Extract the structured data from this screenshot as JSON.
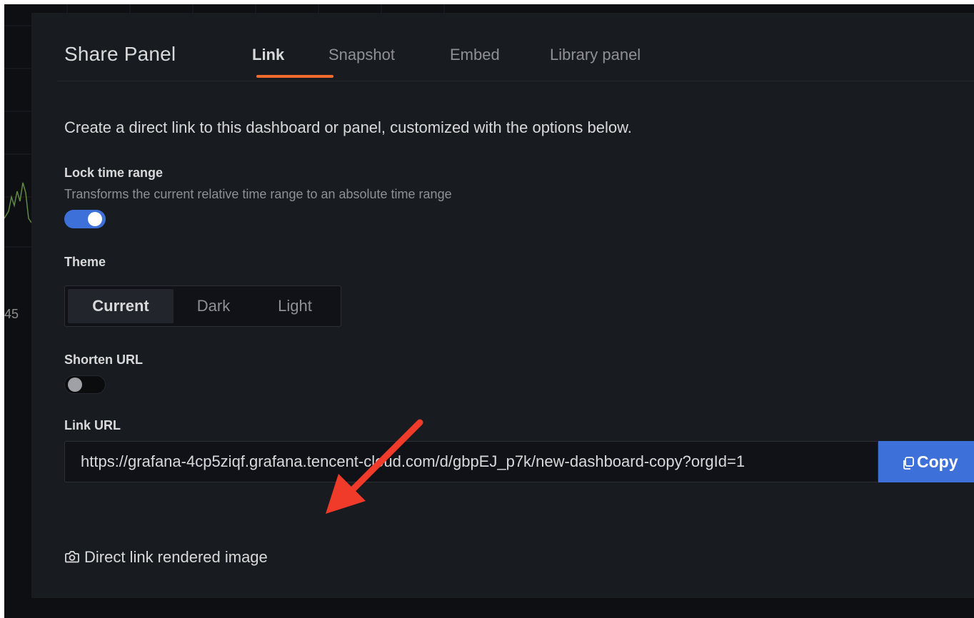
{
  "background": {
    "axis_label": "45"
  },
  "modal": {
    "title": "Share Panel",
    "tabs": [
      {
        "label": "Link",
        "active": true
      },
      {
        "label": "Snapshot",
        "active": false
      },
      {
        "label": "Embed",
        "active": false
      },
      {
        "label": "Library panel",
        "active": false
      }
    ],
    "close_glyph": "×"
  },
  "link_tab": {
    "description": "Create a direct link to this dashboard or panel, customized with the options below.",
    "lock_time_range": {
      "label": "Lock time range",
      "description": "Transforms the current relative time range to an absolute time range",
      "enabled": true
    },
    "theme": {
      "label": "Theme",
      "options": [
        "Current",
        "Dark",
        "Light"
      ],
      "selected": "Current"
    },
    "shorten_url": {
      "label": "Shorten URL",
      "enabled": false
    },
    "link_url": {
      "label": "Link URL",
      "value": "https://grafana-4cp5ziqf.grafana.tencent-cloud.com/d/gbpEJ_p7k/new-dashboard-copy?orgId=1",
      "copy_label": "Copy"
    },
    "rendered_image_label": "Direct link rendered image"
  },
  "icons": [
    "copy-icon",
    "camera-icon",
    "close-icon"
  ],
  "colors": {
    "accent": "#3d71d9",
    "tab_underline": "#f06b2c",
    "annotation_arrow": "#f03a2a"
  }
}
